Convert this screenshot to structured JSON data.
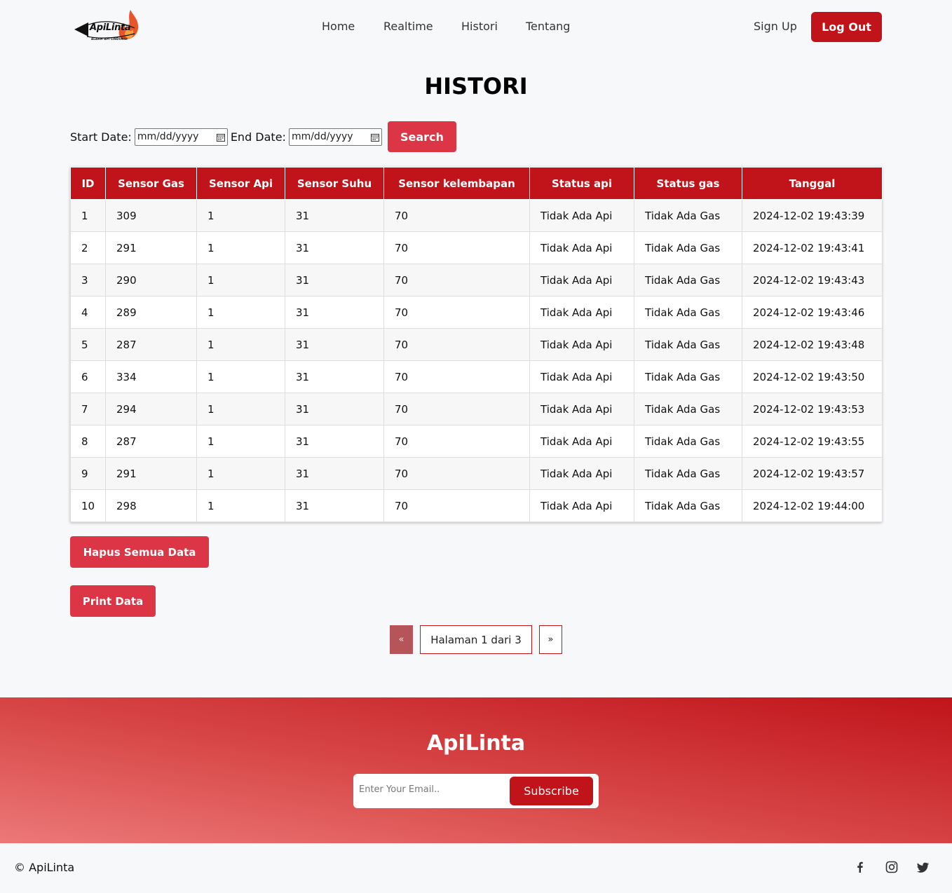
{
  "nav": {
    "brand": "ApiLinta",
    "tagline": "ALARM API LINDUNGI",
    "links": [
      "Home",
      "Realtime",
      "Histori",
      "Tentang"
    ],
    "signup": "Sign Up",
    "logout": "Log Out"
  },
  "page": {
    "title": "HISTORI"
  },
  "filter": {
    "start_label": "Start Date:",
    "end_label": "End Date:",
    "start_placeholder": "mm/dd/yyyy",
    "end_placeholder": "mm/dd/yyyy",
    "search": "Search"
  },
  "table": {
    "headers": [
      "ID",
      "Sensor Gas",
      "Sensor Api",
      "Sensor Suhu",
      "Sensor kelembapan",
      "Status api",
      "Status gas",
      "Tanggal"
    ],
    "rows": [
      [
        "1",
        "309",
        "1",
        "31",
        "70",
        "Tidak Ada Api",
        "Tidak Ada Gas",
        "2024-12-02 19:43:39"
      ],
      [
        "2",
        "291",
        "1",
        "31",
        "70",
        "Tidak Ada Api",
        "Tidak Ada Gas",
        "2024-12-02 19:43:41"
      ],
      [
        "3",
        "290",
        "1",
        "31",
        "70",
        "Tidak Ada Api",
        "Tidak Ada Gas",
        "2024-12-02 19:43:43"
      ],
      [
        "4",
        "289",
        "1",
        "31",
        "70",
        "Tidak Ada Api",
        "Tidak Ada Gas",
        "2024-12-02 19:43:46"
      ],
      [
        "5",
        "287",
        "1",
        "31",
        "70",
        "Tidak Ada Api",
        "Tidak Ada Gas",
        "2024-12-02 19:43:48"
      ],
      [
        "6",
        "334",
        "1",
        "31",
        "70",
        "Tidak Ada Api",
        "Tidak Ada Gas",
        "2024-12-02 19:43:50"
      ],
      [
        "7",
        "294",
        "1",
        "31",
        "70",
        "Tidak Ada Api",
        "Tidak Ada Gas",
        "2024-12-02 19:43:53"
      ],
      [
        "8",
        "287",
        "1",
        "31",
        "70",
        "Tidak Ada Api",
        "Tidak Ada Gas",
        "2024-12-02 19:43:55"
      ],
      [
        "9",
        "291",
        "1",
        "31",
        "70",
        "Tidak Ada Api",
        "Tidak Ada Gas",
        "2024-12-02 19:43:57"
      ],
      [
        "10",
        "298",
        "1",
        "31",
        "70",
        "Tidak Ada Api",
        "Tidak Ada Gas",
        "2024-12-02 19:44:00"
      ]
    ]
  },
  "actions": {
    "delete_all": "Hapus Semua Data",
    "print": "Print Data"
  },
  "pagination": {
    "prev": "«",
    "info": "Halaman 1 dari 3",
    "next": "»"
  },
  "footer": {
    "brand": "ApiLinta",
    "email_placeholder": "Enter Your Email..",
    "subscribe": "Subscribe",
    "copyright": "© ApiLinta",
    "social_icons": [
      "facebook-icon",
      "instagram-icon",
      "twitter-icon"
    ]
  },
  "colors": {
    "primary": "#c0141a",
    "button": "#dc3545",
    "background": "#f7f8fa"
  }
}
